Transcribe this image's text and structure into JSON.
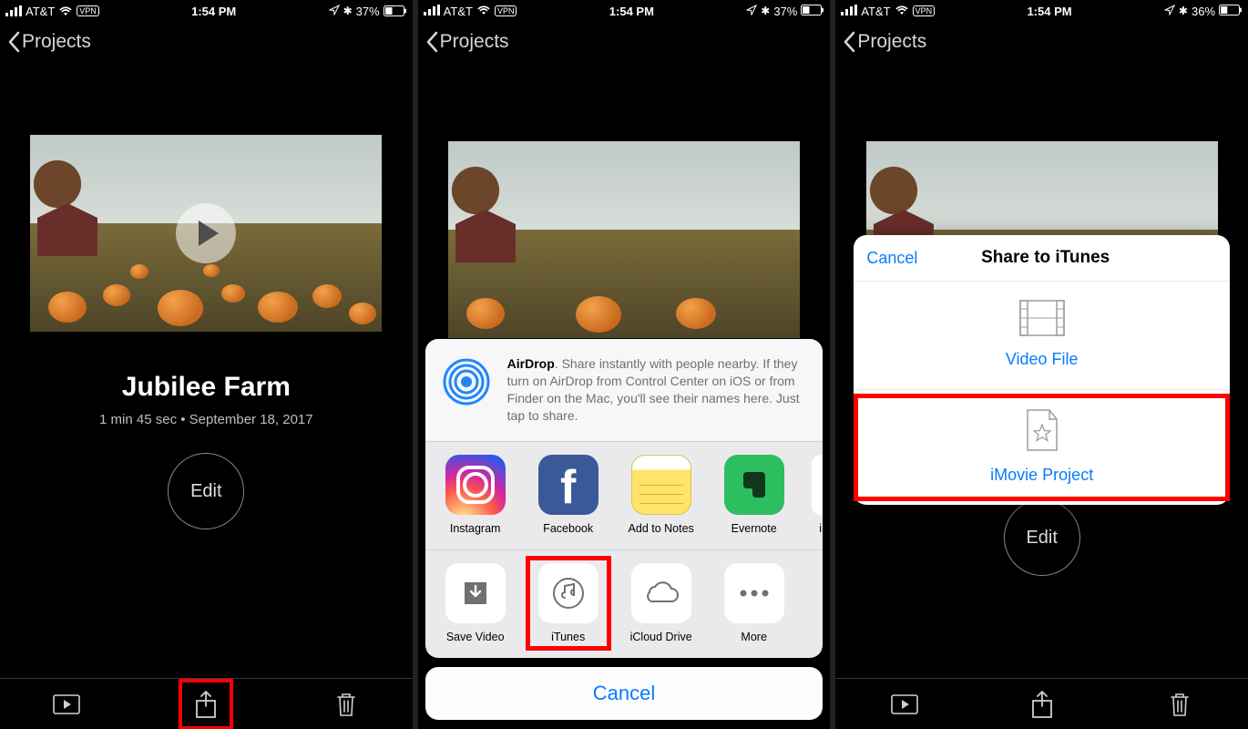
{
  "status": {
    "carrier": "AT&T",
    "vpn": "VPN",
    "time": "1:54 PM",
    "battery1": "37%",
    "battery3": "36%"
  },
  "nav": {
    "back_label": "Projects"
  },
  "project": {
    "title": "Jubilee Farm",
    "meta": "1 min 45 sec • September 18, 2017",
    "edit_label": "Edit"
  },
  "share_sheet": {
    "airdrop_bold": "AirDrop",
    "airdrop_text": ". Share instantly with people nearby. If they turn on AirDrop from Control Center on iOS or from Finder on the Mac, you'll see their names here. Just tap to share.",
    "apps": [
      {
        "label": "Instagram"
      },
      {
        "label": "Facebook"
      },
      {
        "label": "Add to Notes"
      },
      {
        "label": "Evernote"
      }
    ],
    "actions": [
      {
        "label": "Save Video"
      },
      {
        "label": "iTunes"
      },
      {
        "label": "iCloud Drive"
      },
      {
        "label": "More"
      }
    ],
    "cancel": "Cancel"
  },
  "itunes_popover": {
    "cancel": "Cancel",
    "title": "Share to iTunes",
    "options": [
      {
        "label": "Video File"
      },
      {
        "label": "iMovie Project"
      }
    ]
  }
}
